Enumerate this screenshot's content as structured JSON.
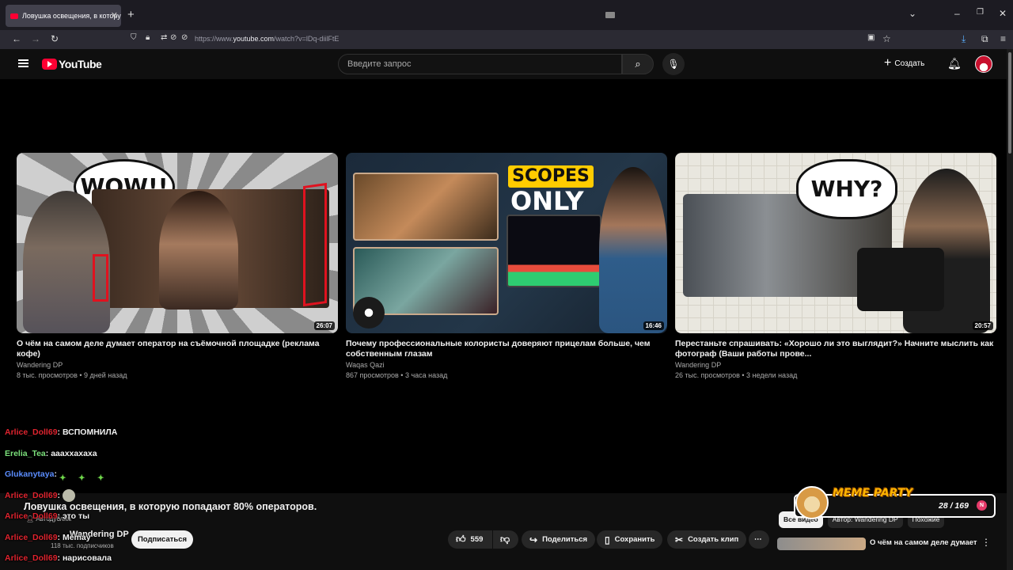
{
  "browser": {
    "tab_title": "Ловушка освещения, в которую",
    "url_prefix": "https://www.",
    "url_host": "youtube.com",
    "url_path": "/watch?v=lDq-diilFtE"
  },
  "header": {
    "logo_text": "YouTube",
    "search_placeholder": "Введите запрос",
    "create_label": "Создать"
  },
  "videos": [
    {
      "title": "О чём на самом деле думает оператор на съёмочной площадке (реклама кофе)",
      "channel": "Wandering DP",
      "meta": "8 тыс. просмотров • 9 дней назад",
      "duration": "26:07",
      "thumb_text": "WOW!!"
    },
    {
      "title": "Почему профессиональные колористы доверяют прицелам больше, чем собственным глазам",
      "channel": "Waqas Qazi",
      "meta": "867 просмотров • 3 часа назад",
      "duration": "16:46",
      "thumb_text_1": "SCOPES",
      "thumb_text_2": "ONLY"
    },
    {
      "title": "Перестаньте спрашивать: «Хорошо ли это выглядит?» Начните мыслить как фотограф (Ваши работы прове...",
      "channel": "Wandering DP",
      "meta": "26 тыс. просмотров • 3 недели назад",
      "duration": "20:57",
      "thumb_text": "WHY?"
    }
  ],
  "player": {
    "title": "Ловушка освещения, в которую попадают 80% операторов.",
    "autodub": "Автодубляж",
    "channel": "Wandering DP",
    "subscribers": "118 тыс. подписчиков",
    "subscribe_label": "Подписаться",
    "likes": "559",
    "share_label": "Поделиться",
    "save_label": "Сохранить",
    "clip_label": "Создать клип"
  },
  "chat": [
    {
      "nick": "Arlice_Doll69",
      "text": "ВСПОМНИЛА",
      "color": "#e0242f"
    },
    {
      "nick": "Erelia_Tea",
      "text": "аааххахаха",
      "color": "#7be07b"
    },
    {
      "nick": "Glukanytaya",
      "text": "",
      "color": "#5b8dff"
    },
    {
      "nick": "Arlice_Doll69",
      "text": "",
      "color": "#e0242f"
    },
    {
      "nick": "Arlice_Doll69",
      "text": "это ты",
      "color": "#e0242f"
    },
    {
      "nick": "Arlice_Doll69",
      "text": "Memay",
      "color": "#e0242f"
    },
    {
      "nick": "Arlice_Doll69",
      "text": "нарисовала",
      "color": "#e0242f"
    }
  ],
  "overlay": {
    "meme_title": "MEME PARTY",
    "meme_count": "28 / 169"
  },
  "sidebar": {
    "chips": [
      "Все видео",
      "Автор: Wandering DP",
      "Похожие"
    ],
    "upnext_title": "О чём на самом деле думает"
  }
}
